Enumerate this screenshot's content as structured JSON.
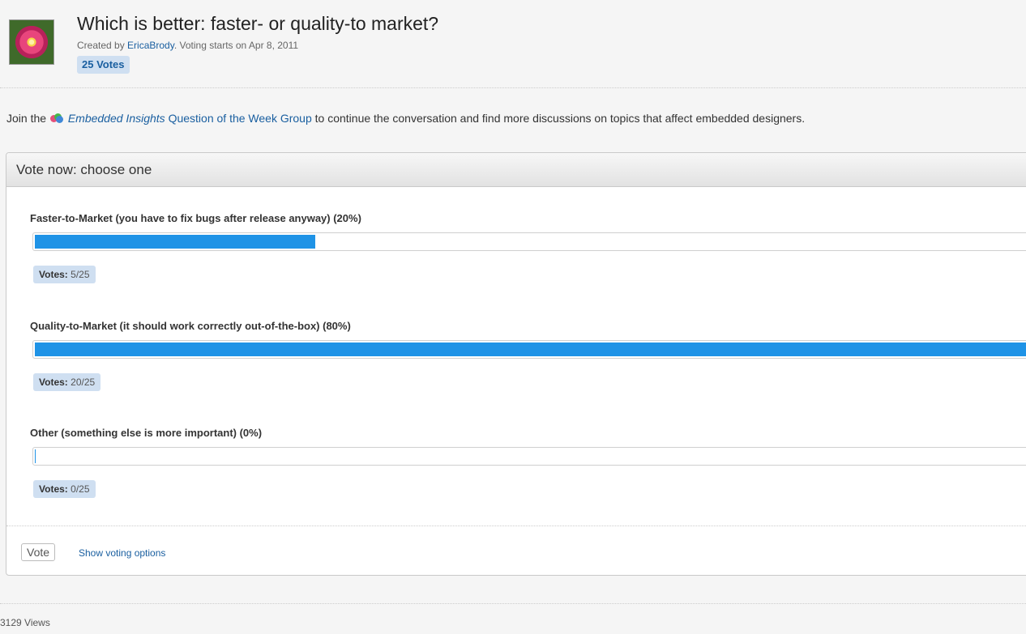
{
  "header": {
    "title": "Which is better: faster- or quality-to market?",
    "created_prefix": "Created by ",
    "author": "EricaBrody",
    "created_suffix": ". Voting starts on Apr 8, 2011",
    "votes_badge": "25 Votes"
  },
  "join": {
    "prefix": "Join the",
    "group_name": "Embedded Insights",
    "group_suffix": " Question of the Week Group",
    "suffix": " to continue the conversation and find more discussions on topics that affect embedded designers."
  },
  "poll": {
    "heading": "Vote now: choose one",
    "votes_label": "Votes:",
    "bar_color": "#1f93e6",
    "options": [
      {
        "label": "Faster-to-Market (you have to fix bugs after release anyway) (20%)",
        "percent": 20,
        "votes": "5/25"
      },
      {
        "label": "Quality-to-Market (it should work correctly out-of-the-box) (80%)",
        "percent": 80,
        "votes": "20/25"
      },
      {
        "label": "Other (something else is more important) (0%)",
        "percent": 0,
        "votes": "0/25"
      }
    ],
    "vote_button": "Vote",
    "show_options_link": "Show voting options"
  },
  "footer": {
    "views": "3129 Views"
  }
}
